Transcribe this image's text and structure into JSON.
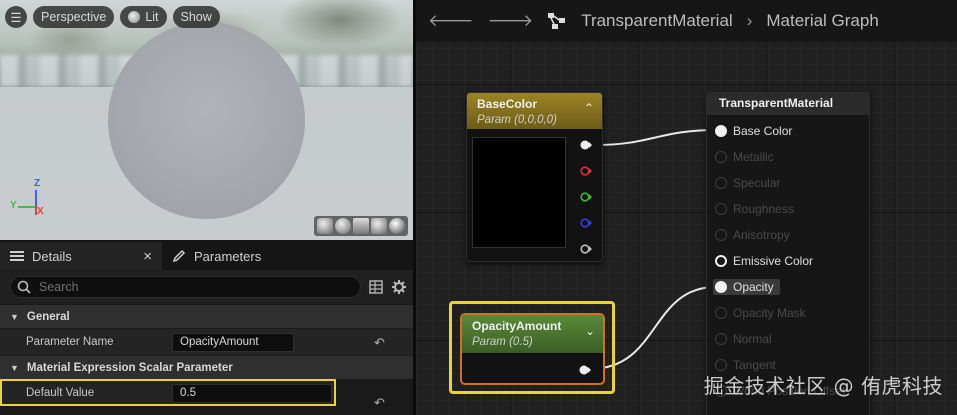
{
  "viewport": {
    "toolbar": {
      "perspective_label": "Perspective",
      "lit_label": "Lit",
      "show_label": "Show"
    },
    "axes": {
      "z": "Z",
      "x": "X",
      "y": "Y"
    },
    "preview_shapes": [
      "cylinder-icon",
      "sphere-icon",
      "plane-icon",
      "cube-icon",
      "teapot-icon"
    ]
  },
  "details": {
    "tabs": [
      {
        "label": "Details",
        "close": "×"
      },
      {
        "label": "Parameters"
      }
    ],
    "search": {
      "placeholder": "Search"
    },
    "sections": [
      {
        "title": "General",
        "properties": [
          {
            "name": "Parameter Name",
            "value": "OpacityAmount"
          }
        ]
      },
      {
        "title": "Material Expression Scalar Parameter",
        "properties": [
          {
            "name": "Default Value",
            "value": "0.5"
          }
        ]
      }
    ]
  },
  "graph": {
    "breadcrumb": {
      "asset": "TransparentMaterial",
      "separator": "›",
      "graph": "Material Graph"
    },
    "nodes": {
      "base_color": {
        "title": "BaseColor",
        "subtitle": "Param (0,0,0,0)",
        "header_color": "#9c8424"
      },
      "opacity": {
        "title": "OpacityAmount",
        "subtitle": "Param (0.5)",
        "header_color": "#5b8a3a",
        "selection_color": "#d46f1e"
      },
      "material": {
        "title": "TransparentMaterial",
        "pins": [
          {
            "label": "Base Color",
            "state": "connected"
          },
          {
            "label": "Metallic",
            "state": "disabled"
          },
          {
            "label": "Specular",
            "state": "disabled"
          },
          {
            "label": "Roughness",
            "state": "disabled"
          },
          {
            "label": "Anisotropy",
            "state": "disabled"
          },
          {
            "label": "Emissive Color",
            "state": "enabled"
          },
          {
            "label": "Opacity",
            "state": "connected"
          },
          {
            "label": "Opacity Mask",
            "state": "disabled"
          },
          {
            "label": "Normal",
            "state": "disabled"
          },
          {
            "label": "Tangent",
            "state": "disabled"
          },
          {
            "label": "World Position Offset",
            "state": "disabled"
          }
        ]
      }
    },
    "pin_colors": {
      "rgba": "#f0f0f0",
      "r": "#e03030",
      "g": "#30c030",
      "b": "#3040e0",
      "a": "#bdbdbd"
    }
  },
  "highlight_color": "#e8d33a",
  "watermark": "掘金技术社区 @ 侑虎科技"
}
